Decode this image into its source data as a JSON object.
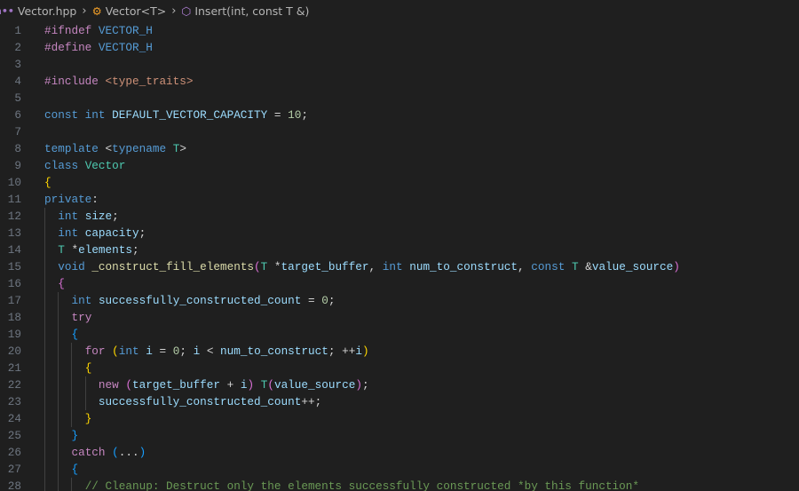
{
  "breadcrumb": {
    "file": "Vector.hpp",
    "class": "Vector<T>",
    "method": "Insert(int, const T &)",
    "icons": [
      "cpp-header-file-icon",
      "class-icon",
      "method-icon"
    ]
  },
  "colors": {
    "background": "#1f1f1f",
    "keyword": "#569cd6",
    "control": "#c586c0",
    "variable": "#9cdcfe",
    "function": "#dcdcaa",
    "type": "#4ec9b0",
    "number": "#b5cea8",
    "string": "#ce9178",
    "comment": "#6a9955"
  },
  "lines": [
    {
      "n": "1",
      "t": [
        [
          "c",
          "#ifndef "
        ],
        [
          "k",
          "VECTOR_H"
        ]
      ]
    },
    {
      "n": "2",
      "t": [
        [
          "c",
          "#define "
        ],
        [
          "k",
          "VECTOR_H"
        ]
      ]
    },
    {
      "n": "3",
      "t": []
    },
    {
      "n": "4",
      "t": [
        [
          "c",
          "#include "
        ],
        [
          "s",
          "<type_traits>"
        ]
      ]
    },
    {
      "n": "5",
      "t": []
    },
    {
      "n": "6",
      "t": [
        [
          "k",
          "const int "
        ],
        [
          "v",
          "DEFAULT_VECTOR_CAPACITY"
        ],
        [
          "p",
          " = "
        ],
        [
          "n",
          "10"
        ],
        [
          "p",
          ";"
        ]
      ]
    },
    {
      "n": "7",
      "t": []
    },
    {
      "n": "8",
      "t": [
        [
          "k",
          "template "
        ],
        [
          "p",
          "<"
        ],
        [
          "k",
          "typename "
        ],
        [
          "t",
          "T"
        ],
        [
          "p",
          ">"
        ]
      ]
    },
    {
      "n": "9",
      "t": [
        [
          "k",
          "class "
        ],
        [
          "t",
          "Vector"
        ]
      ]
    },
    {
      "n": "10",
      "t": [
        [
          "b1",
          "{"
        ]
      ]
    },
    {
      "n": "11",
      "t": [
        [
          "k",
          "private"
        ],
        [
          "p",
          ":"
        ]
      ]
    },
    {
      "n": "12",
      "t": [
        [
          "p",
          "  "
        ],
        [
          "k",
          "int "
        ],
        [
          "v",
          "size"
        ],
        [
          "p",
          ";"
        ]
      ]
    },
    {
      "n": "13",
      "t": [
        [
          "p",
          "  "
        ],
        [
          "k",
          "int "
        ],
        [
          "v",
          "capacity"
        ],
        [
          "p",
          ";"
        ]
      ]
    },
    {
      "n": "14",
      "t": [
        [
          "p",
          "  "
        ],
        [
          "t",
          "T "
        ],
        [
          "p",
          "*"
        ],
        [
          "v",
          "elements"
        ],
        [
          "p",
          ";"
        ]
      ]
    },
    {
      "n": "15",
      "t": [
        [
          "p",
          "  "
        ],
        [
          "k",
          "void "
        ],
        [
          "f",
          "_construct_fill_elements"
        ],
        [
          "b2",
          "("
        ],
        [
          "t",
          "T "
        ],
        [
          "p",
          "*"
        ],
        [
          "v",
          "target_buffer"
        ],
        [
          "p",
          ", "
        ],
        [
          "k",
          "int "
        ],
        [
          "v",
          "num_to_construct"
        ],
        [
          "p",
          ", "
        ],
        [
          "k",
          "const "
        ],
        [
          "t",
          "T "
        ],
        [
          "p",
          "&"
        ],
        [
          "v",
          "value_source"
        ],
        [
          "b2",
          ")"
        ]
      ]
    },
    {
      "n": "16",
      "t": [
        [
          "p",
          "  "
        ],
        [
          "b2",
          "{"
        ]
      ]
    },
    {
      "n": "17",
      "t": [
        [
          "p",
          "    "
        ],
        [
          "k",
          "int "
        ],
        [
          "v",
          "successfully_constructed_count"
        ],
        [
          "p",
          " = "
        ],
        [
          "n",
          "0"
        ],
        [
          "p",
          ";"
        ]
      ]
    },
    {
      "n": "18",
      "t": [
        [
          "p",
          "    "
        ],
        [
          "c",
          "try"
        ]
      ]
    },
    {
      "n": "19",
      "t": [
        [
          "p",
          "    "
        ],
        [
          "b3",
          "{"
        ]
      ]
    },
    {
      "n": "20",
      "t": [
        [
          "p",
          "      "
        ],
        [
          "c",
          "for "
        ],
        [
          "b1",
          "("
        ],
        [
          "k",
          "int "
        ],
        [
          "v",
          "i"
        ],
        [
          "p",
          " = "
        ],
        [
          "n",
          "0"
        ],
        [
          "p",
          "; "
        ],
        [
          "v",
          "i"
        ],
        [
          "p",
          " < "
        ],
        [
          "v",
          "num_to_construct"
        ],
        [
          "p",
          "; ++"
        ],
        [
          "v",
          "i"
        ],
        [
          "b1",
          ")"
        ]
      ]
    },
    {
      "n": "21",
      "t": [
        [
          "p",
          "      "
        ],
        [
          "b1",
          "{"
        ]
      ]
    },
    {
      "n": "22",
      "t": [
        [
          "p",
          "        "
        ],
        [
          "c",
          "new "
        ],
        [
          "b2",
          "("
        ],
        [
          "v",
          "target_buffer"
        ],
        [
          "p",
          " + "
        ],
        [
          "v",
          "i"
        ],
        [
          "b2",
          ")"
        ],
        [
          "p",
          " "
        ],
        [
          "t",
          "T"
        ],
        [
          "b2",
          "("
        ],
        [
          "v",
          "value_source"
        ],
        [
          "b2",
          ")"
        ],
        [
          "p",
          ";"
        ]
      ]
    },
    {
      "n": "23",
      "t": [
        [
          "p",
          "        "
        ],
        [
          "v",
          "successfully_constructed_count"
        ],
        [
          "p",
          "++;"
        ]
      ]
    },
    {
      "n": "24",
      "t": [
        [
          "p",
          "      "
        ],
        [
          "b1",
          "}"
        ]
      ]
    },
    {
      "n": "25",
      "t": [
        [
          "p",
          "    "
        ],
        [
          "b3",
          "}"
        ]
      ]
    },
    {
      "n": "26",
      "t": [
        [
          "p",
          "    "
        ],
        [
          "c",
          "catch "
        ],
        [
          "b3",
          "("
        ],
        [
          "p",
          "..."
        ],
        [
          "b3",
          ")"
        ]
      ]
    },
    {
      "n": "27",
      "t": [
        [
          "p",
          "    "
        ],
        [
          "b3",
          "{"
        ]
      ]
    },
    {
      "n": "28",
      "t": [
        [
          "p",
          "      "
        ],
        [
          "m",
          "// Cleanup: Destruct only the elements successfully constructed *by this function*"
        ]
      ]
    }
  ]
}
